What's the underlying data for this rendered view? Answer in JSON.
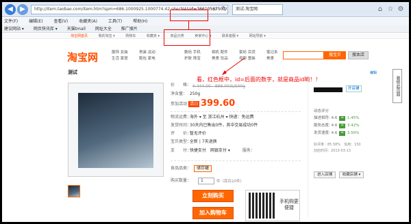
{
  "browser": {
    "url_prefix": "http://item.taobao.com/item.htm?spm=686.1000925.1000774.42.s6ecN4&",
    "url_highlight": "id=36610567503",
    "tab_title": "测试-淘宝网",
    "menu": [
      "文件(F)",
      "编辑(E)",
      "查看(V)",
      "收藏夹(A)",
      "工具(T)",
      "帮助(H)"
    ],
    "favorites": [
      "建议网站 ▾",
      "网页快讯库 ▾",
      "天猫tmall",
      "网址大全",
      "推广搜片"
    ],
    "toolbar_links": [
      "淘宝网首页",
      "我的淘宝 ▾",
      "购物车",
      "收藏夹 ▾",
      "商品分类",
      "卖家中心 ▾",
      "联系客服 ▾",
      "网站导航 ▾"
    ]
  },
  "taobao": {
    "logo": "淘宝网",
    "channel_titles": [
      "服饰",
      "数码",
      "家居",
      "美食",
      "母婴"
    ],
    "channel_cols": [
      [
        "服饰 女装",
        "生活 家居"
      ],
      [
        "男装 运动",
        "鞋包 家电"
      ],
      [
        "数码 手机",
        "护肤 珠宝"
      ],
      [
        "相机 配件",
        "美食 饮品"
      ],
      [
        "家纺 百货",
        "母婴 童装"
      ],
      [
        "笔记本",
        "美食"
      ]
    ],
    "search_button": "搜宝贝",
    "shop_button": "搜本店",
    "item_title": "测试",
    "edit_link": "编辑",
    "side_tool": "装修此页面"
  },
  "item": {
    "price_label": "价　　格：",
    "price_strike": "¥ 444.00",
    "price_range": "888.00元/500g",
    "weight_label": "净含量：",
    "weight_value": "250g",
    "promo_label": "参加活动：",
    "promo_badge": "活动",
    "currency_sign": "¥",
    "promo_price": "399.60",
    "ship_label": "物流运费：",
    "ship_value": "海外 ▾ 至 浙江杭州 ▾ 快递：免运费",
    "deliver_label": "发货时间：",
    "deliver_value": "30天内已售出0件，其中交易成功0件",
    "review_label": "评　　价：",
    "review_value": "暂无评价",
    "points_label": "宝贝类型：",
    "points_value": "全新 | 7天退换",
    "pay_label": "支　　付：",
    "pay_value": "快捷支付　网银支付 ▾",
    "service_label": "服务：",
    "tag_label": "食品品类：",
    "tag_value": "储存罐",
    "qty_label": "购买数量：",
    "qty_value": "1",
    "qty_unit": "件（库存20件）",
    "buy_button": "立刻购买",
    "cart_button": "加入购物车",
    "qr_text": "手机购更便捷"
  },
  "seller": {
    "badge": "开店铺",
    "rate_title": "动态评分",
    "rates": [
      {
        "label": "描述相符",
        "score": "4.6",
        "pct": "1.45%"
      },
      {
        "label": "服务态度",
        "score": "4.6",
        "pct": "3.42%"
      },
      {
        "label": "发货速度",
        "score": "4.6",
        "pct": "3.50%"
      }
    ],
    "line1": "好评率：85.58%　信用：150",
    "line2": "创店时间：2013-03-13",
    "enter_shop": "进入店铺",
    "fav_shop": "收藏店铺 ▾"
  },
  "annotation": {
    "text": "看，红色框中，id=后面的数字，就是商品id哟！！",
    "color": "#e00000"
  }
}
